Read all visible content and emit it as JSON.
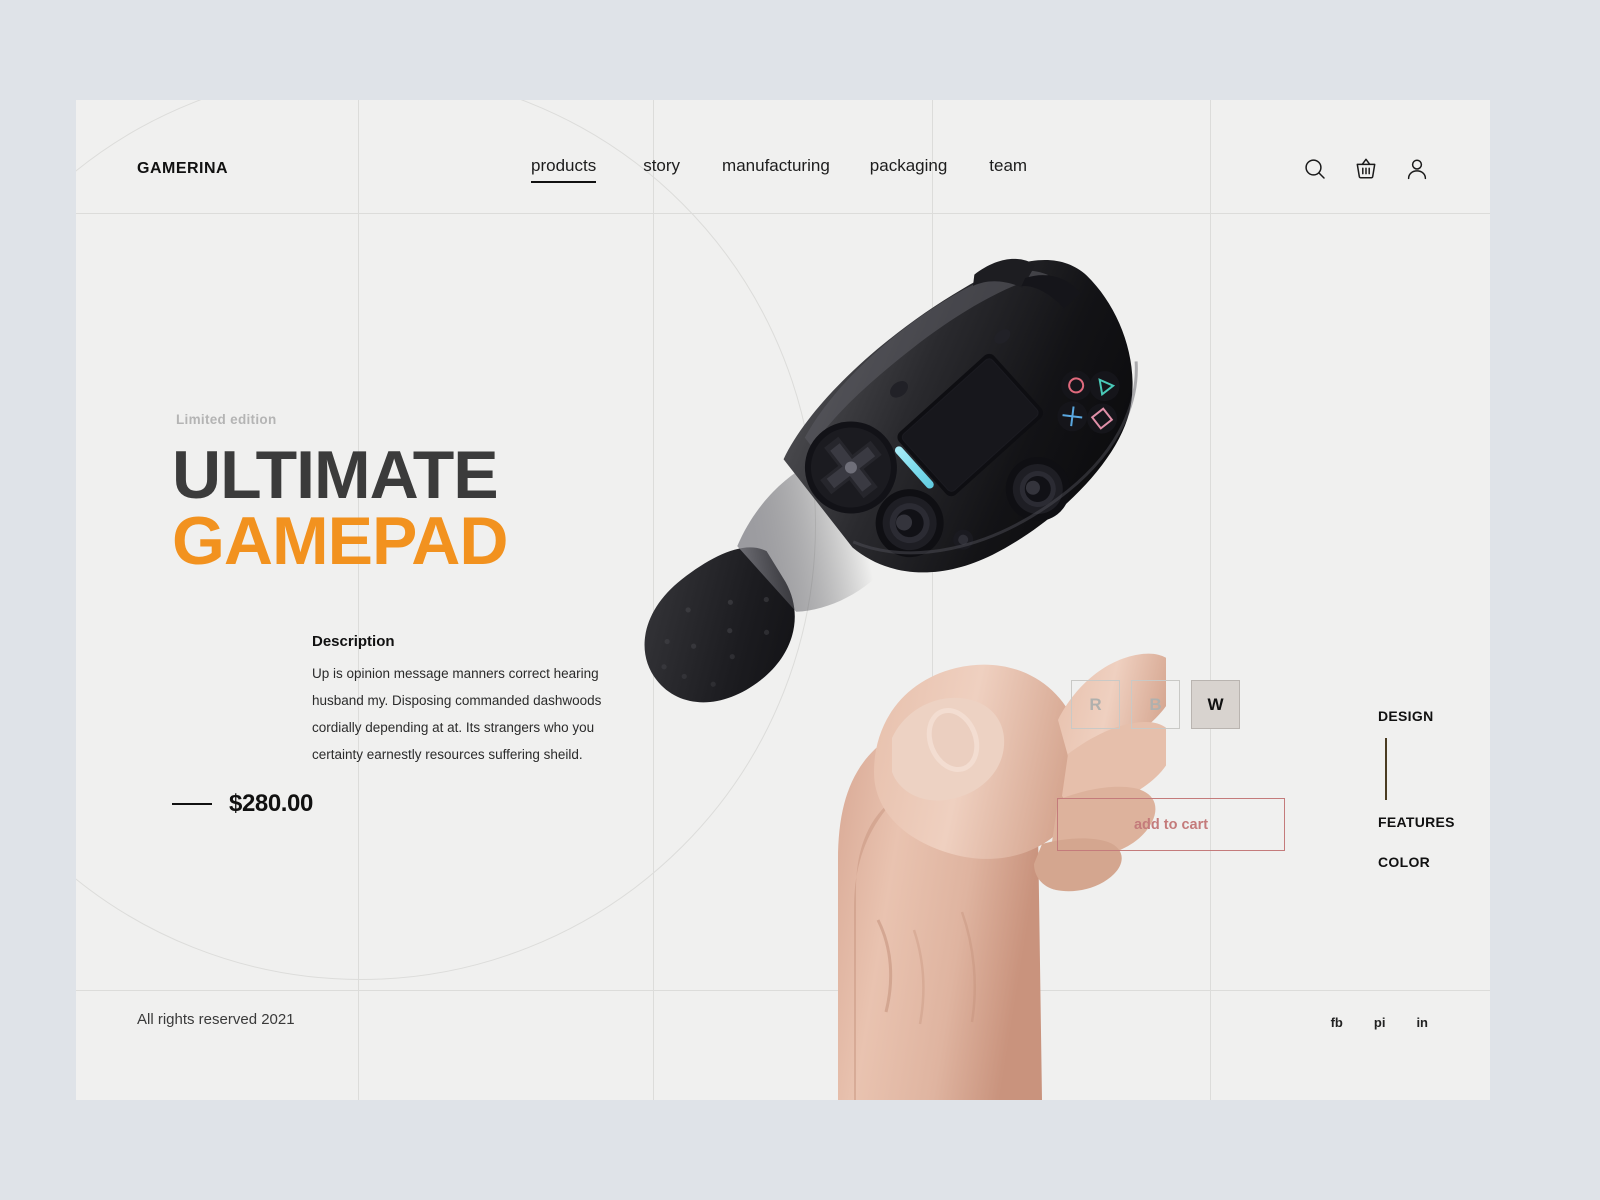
{
  "brand": {
    "name": "GAMERINA"
  },
  "nav": {
    "items": [
      {
        "label": "products",
        "active": true
      },
      {
        "label": "story",
        "active": false
      },
      {
        "label": "manufacturing",
        "active": false
      },
      {
        "label": "packaging",
        "active": false
      },
      {
        "label": "team",
        "active": false
      }
    ]
  },
  "header_icons": [
    {
      "name": "search-icon"
    },
    {
      "name": "basket-icon"
    },
    {
      "name": "user-icon"
    }
  ],
  "hero": {
    "eyebrow": "Limited edition",
    "title_line1": "ULTIMATE",
    "title_line2": "GAMEPAD",
    "description_heading": "Description",
    "description_body": "Up is opinion message manners correct hearing husband my. Disposing commanded dashwoods cordially depending at at. Its strangers who you certainty earnestly resources suffering sheild.",
    "price": "$280.00"
  },
  "product": {
    "alt": "black gamepad controller held in a hand"
  },
  "options": {
    "swatches": [
      {
        "label": "R",
        "selected": false
      },
      {
        "label": "B",
        "selected": false
      },
      {
        "label": "W",
        "selected": true
      }
    ]
  },
  "cart": {
    "button_label": "add to cart"
  },
  "side_menu": {
    "items": [
      {
        "label": "DESIGN"
      },
      {
        "label": "FEATURES"
      },
      {
        "label": "COLOR"
      }
    ]
  },
  "footer": {
    "copyright": "All rights reserved 2021",
    "socials": [
      {
        "label": "fb"
      },
      {
        "label": "pi"
      },
      {
        "label": "in"
      }
    ]
  },
  "colors": {
    "page_background": "#dfe3e8",
    "card_background": "#f0f0ef",
    "accent_orange": "#f2921f",
    "title_dark": "#3b3b3b",
    "cart_rose": "#c47b7b",
    "grid_line": "#dcdcda",
    "swatch_selected": "#d8d3cf"
  }
}
